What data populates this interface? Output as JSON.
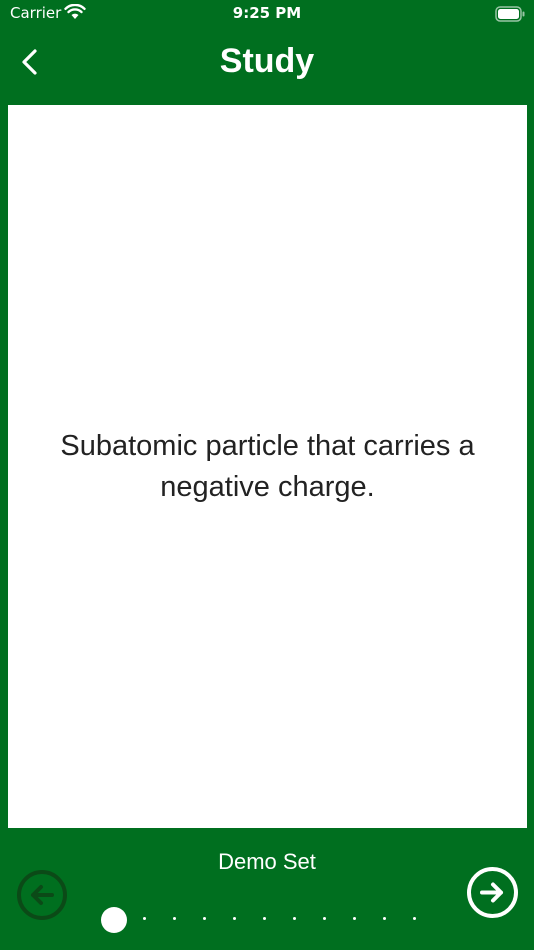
{
  "status_bar": {
    "carrier": "Carrier",
    "time": "9:25 PM"
  },
  "nav": {
    "title": "Study",
    "back_icon": "chevron-left-icon"
  },
  "card": {
    "text": "Subatomic particle that carries a negative charge."
  },
  "footer": {
    "set_name": "Demo Set",
    "prev_icon": "arrow-left-circle-icon",
    "next_icon": "arrow-right-circle-icon",
    "page_count": 11,
    "current_page": 1
  },
  "colors": {
    "background": "#006f1f",
    "card": "#ffffff",
    "text": "#222222",
    "disabled_button": "#0b4a17"
  }
}
